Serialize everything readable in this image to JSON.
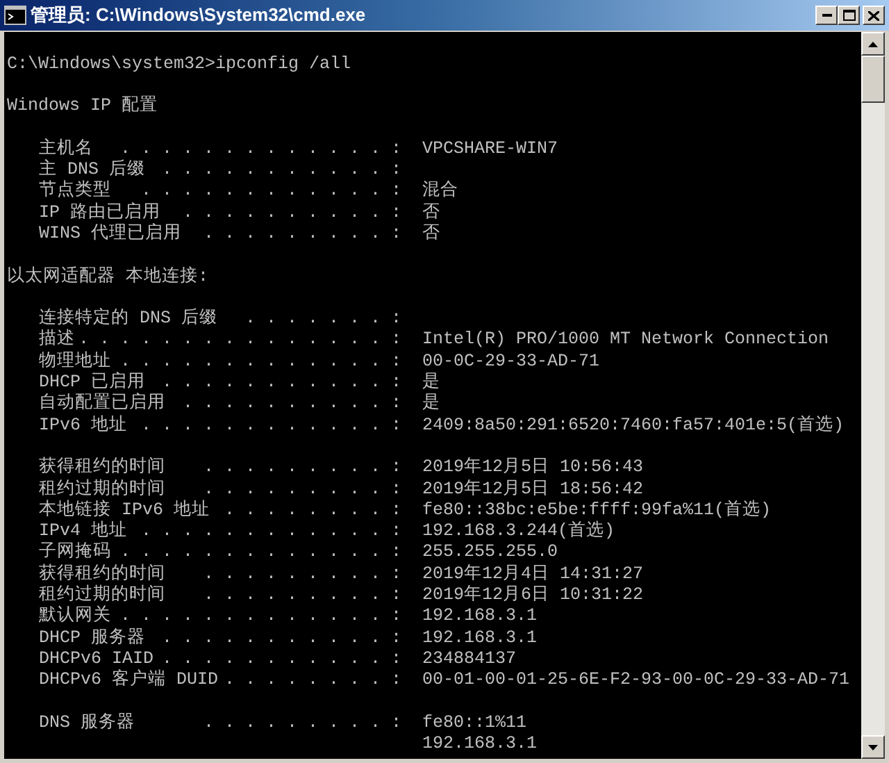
{
  "window": {
    "title": "管理员: C:\\Windows\\System32\\cmd.exe"
  },
  "console": {
    "lines": [
      {
        "kind": "blank"
      },
      {
        "kind": "text",
        "text": "C:\\Windows\\system32>ipconfig /all"
      },
      {
        "kind": "blank"
      },
      {
        "kind": "text",
        "text": "Windows IP 配置"
      },
      {
        "kind": "blank"
      },
      {
        "kind": "entry",
        "label": "主机名",
        "leader": ". . . . . . . . . . . . . :",
        "value": "VPCSHARE-WIN7"
      },
      {
        "kind": "entry",
        "label": "主 DNS 后缀",
        "leader": ". . . . . . . . . . . :"
      },
      {
        "kind": "entry",
        "label": "节点类型",
        "leader": ". . . . . . . . . . . . :",
        "value": "混合"
      },
      {
        "kind": "entry",
        "label": "IP 路由已启用",
        "leader": ". . . . . . . . . . :",
        "value": "否"
      },
      {
        "kind": "entry",
        "label": "WINS 代理已启用",
        "leader": ". . . . . . . . . :",
        "value": "否"
      },
      {
        "kind": "blank"
      },
      {
        "kind": "text",
        "text": "以太网适配器 本地连接:"
      },
      {
        "kind": "blank"
      },
      {
        "kind": "entry",
        "label": "连接特定的 DNS 后缀",
        "leader": ". . . . . . . :"
      },
      {
        "kind": "entry",
        "label": "描述",
        "leader": ". . . . . . . . . . . . . . . :",
        "value": "Intel(R) PRO/1000 MT Network Connection"
      },
      {
        "kind": "entry",
        "label": "物理地址",
        "leader": ". . . . . . . . . . . . . :",
        "value": "00-0C-29-33-AD-71"
      },
      {
        "kind": "entry",
        "label": "DHCP 已启用",
        "leader": ". . . . . . . . . . . :",
        "value": "是"
      },
      {
        "kind": "entry",
        "label": "自动配置已启用",
        "leader": ". . . . . . . . . . :",
        "value": "是"
      },
      {
        "kind": "entry",
        "label": "IPv6 地址",
        "leader": ". . . . . . . . . . . . :",
        "value": "2409:8a50:291:6520:7460:fa57:401e:5(首选)"
      },
      {
        "kind": "blank"
      },
      {
        "kind": "entry",
        "label": "获得租约的时间",
        "leader": ". . . . . . . . . :",
        "value": "2019年12月5日 10:56:43"
      },
      {
        "kind": "entry",
        "label": "租约过期的时间",
        "leader": ". . . . . . . . . :",
        "value": "2019年12月5日 18:56:42"
      },
      {
        "kind": "entry",
        "label": "本地链接 IPv6 地址",
        "leader": ". . . . . . . . :",
        "value": "fe80::38bc:e5be:ffff:99fa%11(首选)"
      },
      {
        "kind": "entry",
        "label": "IPv4 地址",
        "leader": ". . . . . . . . . . . . :",
        "value": "192.168.3.244(首选)"
      },
      {
        "kind": "entry",
        "label": "子网掩码",
        "leader": ". . . . . . . . . . . . . :",
        "value": "255.255.255.0"
      },
      {
        "kind": "entry",
        "label": "获得租约的时间",
        "leader": ". . . . . . . . . :",
        "value": "2019年12月4日 14:31:27"
      },
      {
        "kind": "entry",
        "label": "租约过期的时间",
        "leader": ". . . . . . . . . :",
        "value": "2019年12月6日 10:31:22"
      },
      {
        "kind": "entry",
        "label": "默认网关",
        "leader": ". . . . . . . . . . . . . :",
        "value": "192.168.3.1"
      },
      {
        "kind": "entry",
        "label": "DHCP 服务器",
        "leader": ". . . . . . . . . . . :",
        "value": "192.168.3.1"
      },
      {
        "kind": "entry",
        "label": "DHCPv6 IAID",
        "leader": ". . . . . . . . . . . :",
        "value": "234884137"
      },
      {
        "kind": "entry",
        "label": "DHCPv6 客户端 DUID",
        "leader": ". . . . . . . . :",
        "value": "00-01-00-01-25-6E-F2-93-00-0C-29-33-AD-71"
      },
      {
        "kind": "blank"
      },
      {
        "kind": "entry",
        "label": "DNS 服务器",
        "leader": ". . . . . . . . . :",
        "value": "fe80::1%11"
      },
      {
        "kind": "continuation",
        "value": "192.168.3.1"
      }
    ]
  }
}
